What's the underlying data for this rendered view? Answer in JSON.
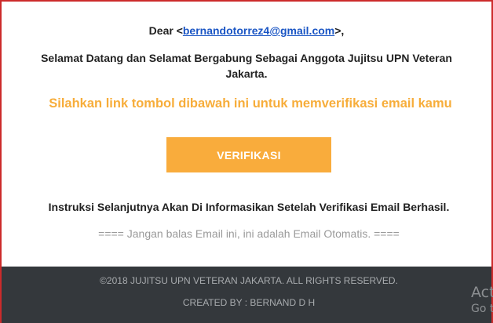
{
  "email": {
    "greeting_prefix": "Dear <",
    "greeting_email": "bernandotorrez4@gmail.com",
    "greeting_suffix": ">,",
    "welcome_text": "Selamat Datang dan Selamat Bergabung Sebagai Anggota Jujitsu UPN Veteran Jakarta.",
    "instruction_highlight": "Silahkan link tombol dibawah ini untuk memverifikasi email kamu",
    "verify_button_label": "VERIFIKASI",
    "next_steps_text": "Instruksi Selanjutnya Akan Di Informasikan Setelah Verifikasi Email Berhasil.",
    "no_reply_text": "==== Jangan balas Email ini, ini adalah Email Otomatis. ===="
  },
  "footer": {
    "copyright": "©2018 JUJITSU UPN VETERAN JAKARTA. ALL RIGHTS RESERVED.",
    "created_by": "CREATED BY : BERNAND D H"
  },
  "overlay": {
    "watermark_line1": "Act",
    "watermark_line2": "Go t"
  },
  "colors": {
    "frame": "#cc2b2b",
    "accent_orange": "#f9ac3c",
    "link_blue": "#1a55c4",
    "footer_bg": "#34383c"
  }
}
